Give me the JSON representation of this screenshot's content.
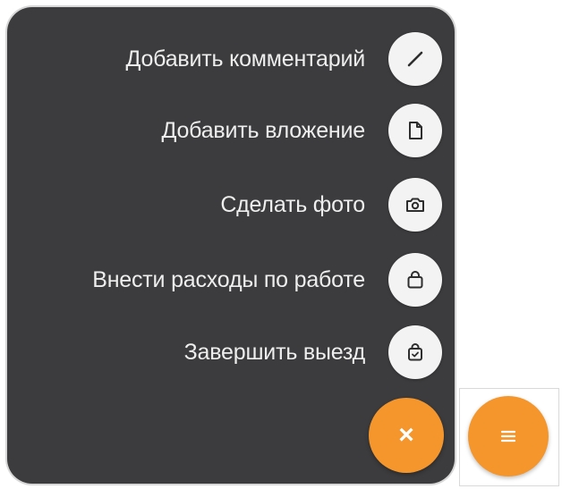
{
  "menu": {
    "items": [
      {
        "label": "Добавить комментарий",
        "icon": "pencil-icon"
      },
      {
        "label": "Добавить вложение",
        "icon": "file-icon"
      },
      {
        "label": "Сделать фото",
        "icon": "camera-icon"
      },
      {
        "label": "Внести расходы по работе",
        "icon": "bag-icon"
      },
      {
        "label": "Завершить выезд",
        "icon": "bag-check-icon"
      }
    ]
  },
  "fab_close": {
    "icon": "close-icon",
    "glyph": "×"
  },
  "fab_menu": {
    "icon": "menu-icon"
  },
  "colors": {
    "panel_bg": "#3c3c3e",
    "accent": "#f4962c",
    "icon_button_bg": "#f3f3f3",
    "label_text": "#eeeeee"
  }
}
